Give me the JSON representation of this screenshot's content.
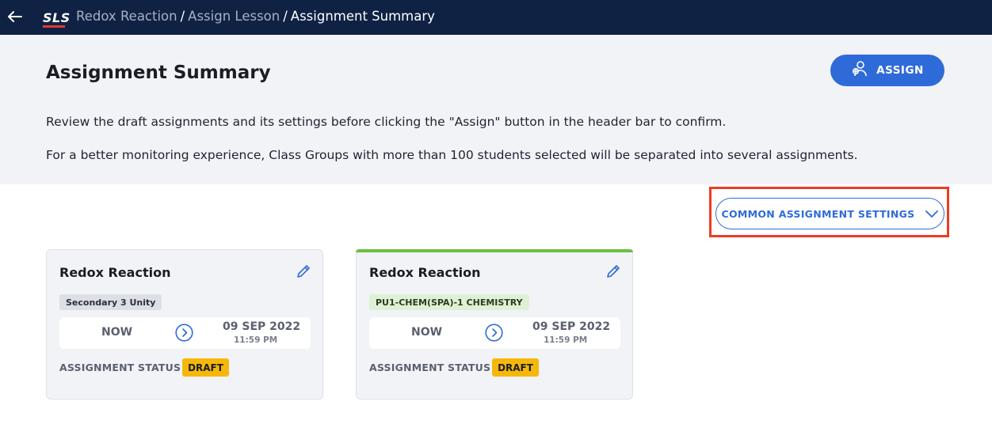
{
  "header": {
    "logo": "SLS",
    "breadcrumb": [
      {
        "label": "Redox Reaction"
      },
      {
        "label": "Assign Lesson"
      },
      {
        "label": "Assignment Summary"
      }
    ],
    "separator": "/"
  },
  "summary": {
    "title": "Assignment Summary",
    "assign_label": "ASSIGN",
    "info_line_1": "Review the draft assignments and its settings before clicking the \"Assign\" button in the header bar to confirm.",
    "info_line_2": "For a better monitoring experience, Class Groups with more than 100 students selected will be separated into several assignments."
  },
  "settings": {
    "label": "COMMON ASSIGNMENT SETTINGS",
    "highlight_color": "#ef3b24"
  },
  "cards": [
    {
      "title": "Redox Reaction",
      "tag": "Secondary 3 Unity",
      "start": "NOW",
      "due_date": "09 SEP 2022",
      "due_time": "11:59 PM",
      "status_label": "ASSIGNMENT STATUS",
      "status": "DRAFT"
    },
    {
      "title": "Redox Reaction",
      "tag": "PU1-CHEM(SPA)-1 CHEMISTRY",
      "start": "NOW",
      "due_date": "09 SEP 2022",
      "due_time": "11:59 PM",
      "status_label": "ASSIGNMENT STATUS",
      "status": "DRAFT"
    }
  ],
  "colors": {
    "header_bg": "#0f2244",
    "primary": "#2f6bd8",
    "draft_badge": "#f5b80a",
    "card_accent": "#6cbf3f"
  }
}
